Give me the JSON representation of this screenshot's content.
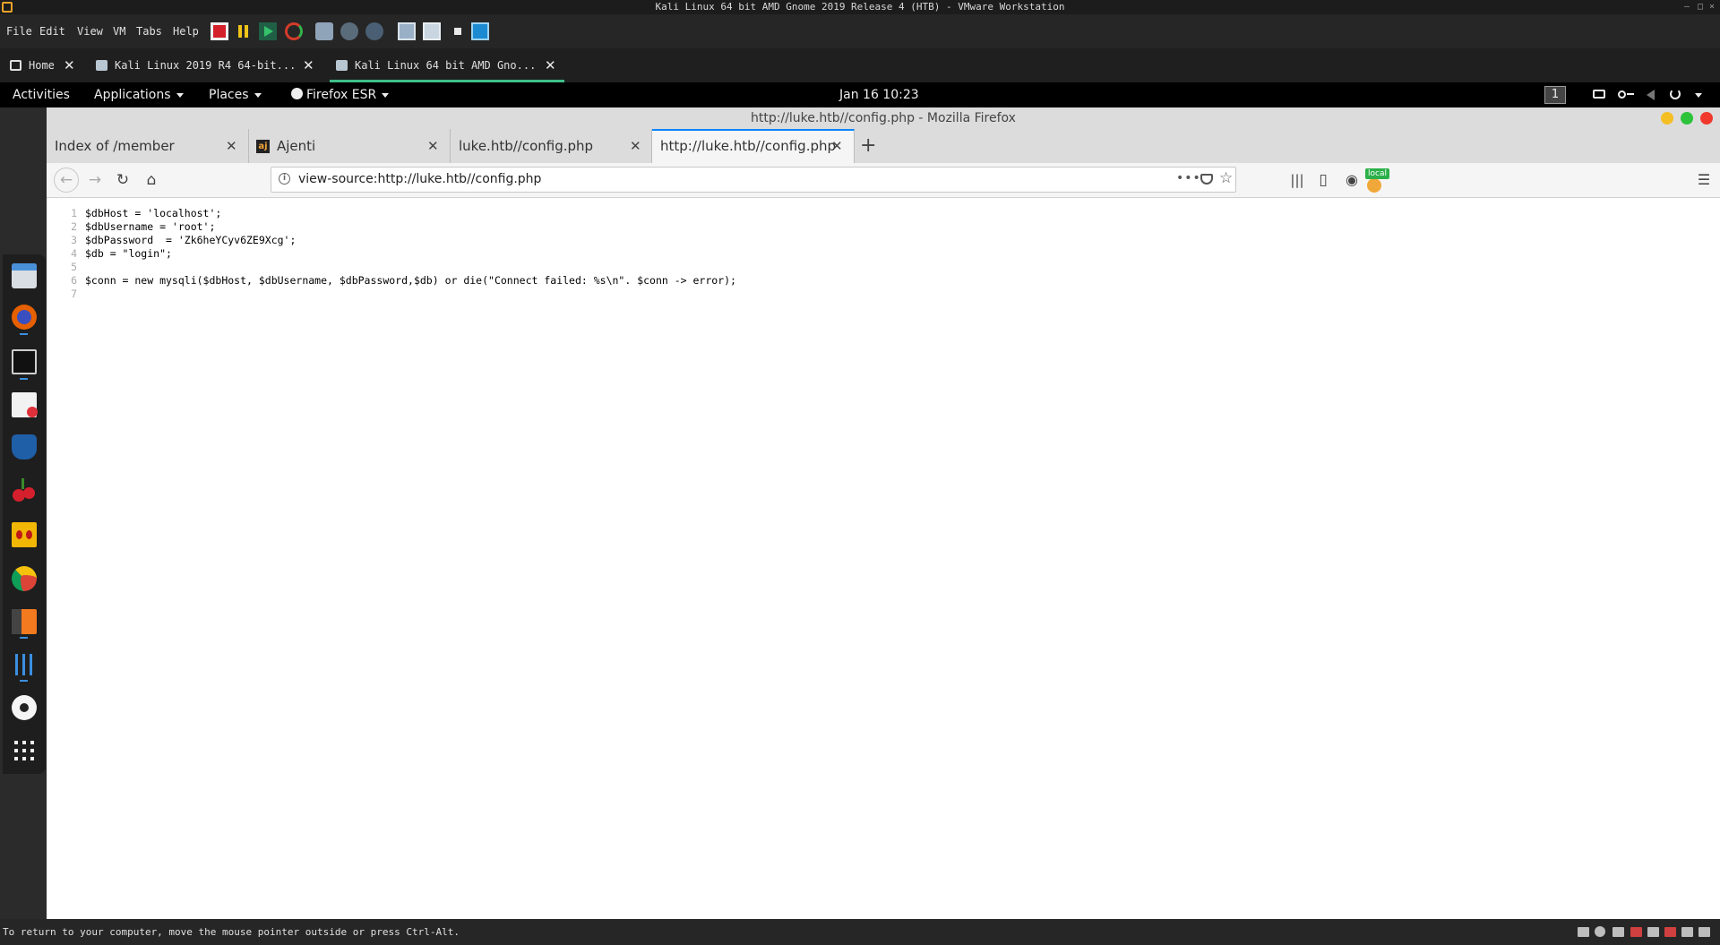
{
  "vmware": {
    "title": "Kali Linux 64 bit AMD Gnome 2019 Release 4 (HTB) - VMware Workstation",
    "window_controls": [
      "–",
      "□",
      "×"
    ],
    "menu": [
      "File",
      "Edit",
      "View",
      "VM",
      "Tabs",
      "Help"
    ],
    "tabs": [
      {
        "label": "Home",
        "icon": "home-icon"
      },
      {
        "label": "Kali Linux 2019 R4 64-bit...",
        "icon": "vm-icon"
      },
      {
        "label": "Kali Linux 64 bit AMD Gno...",
        "icon": "vm-icon",
        "active": true
      }
    ],
    "status_text": "To return to your computer, move the mouse pointer outside or press Ctrl-Alt."
  },
  "gnome": {
    "activities": "Activities",
    "applications": "Applications",
    "places": "Places",
    "firefox_menu": "Firefox ESR",
    "clock": "Jan 16  10:23",
    "workspace": "1"
  },
  "dock": {
    "items": [
      "files-icon",
      "firefox-icon",
      "terminal-icon",
      "text-editor-icon",
      "metasploit-icon",
      "cherrytree-icon",
      "maltego-icon",
      "chrome-icon",
      "burpsuite-icon",
      "settings-tool-icon",
      "disc-icon",
      "show-apps-icon"
    ]
  },
  "firefox": {
    "window_title": "http://luke.htb//config.php - Mozilla Firefox",
    "tabs": [
      {
        "label": "Index of /member"
      },
      {
        "label": "Ajenti"
      },
      {
        "label": "luke.htb//config.php"
      },
      {
        "label": "http://luke.htb//config.php",
        "active": true
      }
    ],
    "new_tab": "+",
    "url": "view-source:http://luke.htb//config.php",
    "badge": "local"
  },
  "source": {
    "line_numbers": [
      "1",
      "2",
      "3",
      "4",
      "5",
      "6",
      "7"
    ],
    "lines": [
      "$dbHost = 'localhost';",
      "$dbUsername = 'root';",
      "$dbPassword  = 'Zk6heYCyv6ZE9Xcg';",
      "$db = \"login\";",
      "",
      "$conn = new mysqli($dbHost, $dbUsername, $dbPassword,$db) or die(\"Connect failed: %s\\n\". $conn -> error);",
      ""
    ]
  },
  "colors": {
    "accent": "#0a84ff",
    "vm_tab_underline": "#3fbf8a",
    "dock_indicator": "#3b8fe0"
  }
}
